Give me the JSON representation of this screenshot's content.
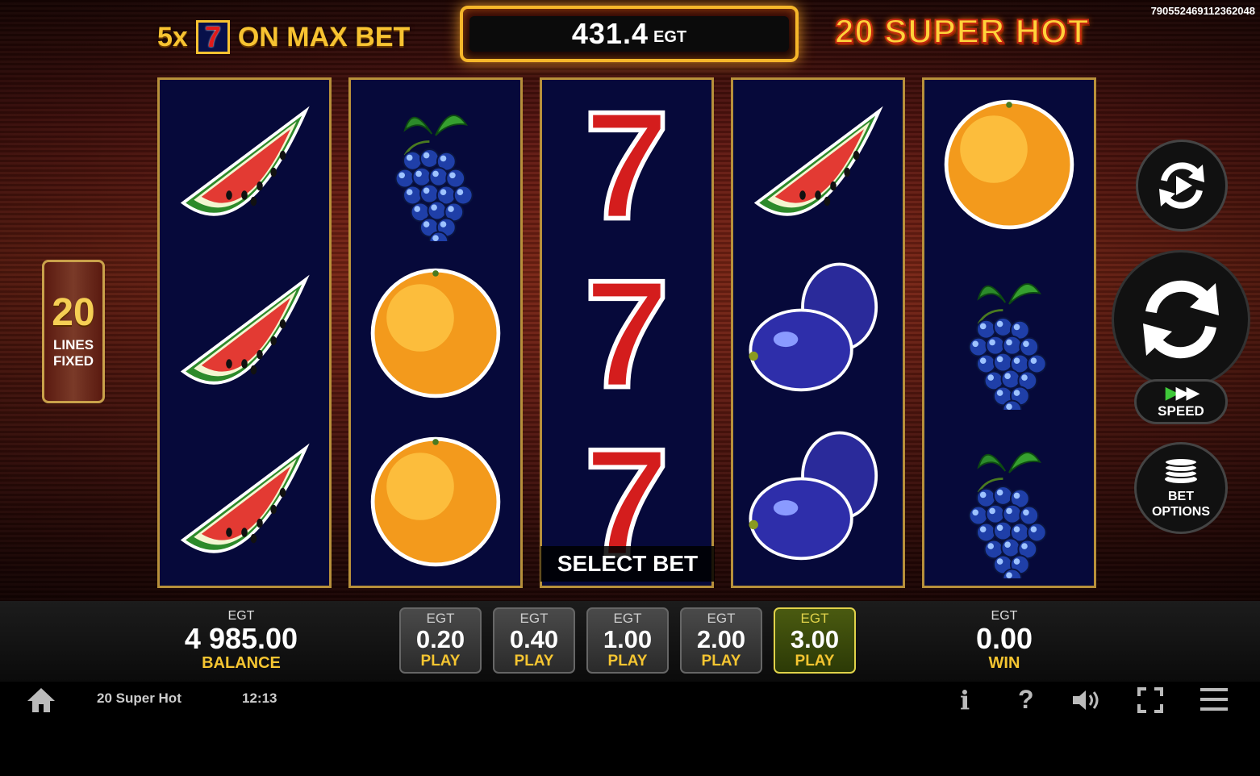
{
  "header": {
    "promo_prefix": "5x",
    "promo_seven": "7",
    "promo_suffix": "ON MAX BET",
    "jackpot_amount": "431.4",
    "jackpot_currency": "EGT",
    "logo": "20 SUPER HOT",
    "game_id": "790552469112362048"
  },
  "lines": {
    "count": "20",
    "label_line1": "LINES",
    "label_line2": "FIXED"
  },
  "reels": [
    [
      "watermelon",
      "watermelon",
      "watermelon"
    ],
    [
      "grapes",
      "orange",
      "orange"
    ],
    [
      "seven",
      "seven",
      "seven"
    ],
    [
      "watermelon",
      "plum",
      "plum"
    ],
    [
      "orange",
      "grapes",
      "grapes"
    ]
  ],
  "select_bet_label": "SELECT BET",
  "controls": {
    "autoplay_icon": "autoplay-icon",
    "spin_icon": "spin-icon",
    "speed_label": "SPEED",
    "bet_options_line1": "BET",
    "bet_options_line2": "OPTIONS"
  },
  "balance": {
    "currency": "EGT",
    "value": "4 985.00",
    "label": "BALANCE"
  },
  "win": {
    "currency": "EGT",
    "value": "0.00",
    "label": "WIN"
  },
  "bets": [
    {
      "currency": "EGT",
      "value": "0.20",
      "label": "PLAY",
      "active": false
    },
    {
      "currency": "EGT",
      "value": "0.40",
      "label": "PLAY",
      "active": false
    },
    {
      "currency": "EGT",
      "value": "1.00",
      "label": "PLAY",
      "active": false
    },
    {
      "currency": "EGT",
      "value": "2.00",
      "label": "PLAY",
      "active": false
    },
    {
      "currency": "EGT",
      "value": "3.00",
      "label": "PLAY",
      "active": true
    }
  ],
  "footer": {
    "title": "20 Super Hot",
    "clock": "12:13",
    "icons": [
      "home-icon",
      "info-icon",
      "help-icon",
      "sound-icon",
      "fullscreen-icon",
      "menu-icon"
    ]
  },
  "colors": {
    "accent_gold": "#f5c531",
    "active_bet": "#e0d24a",
    "reel_bg": "#06093a"
  }
}
